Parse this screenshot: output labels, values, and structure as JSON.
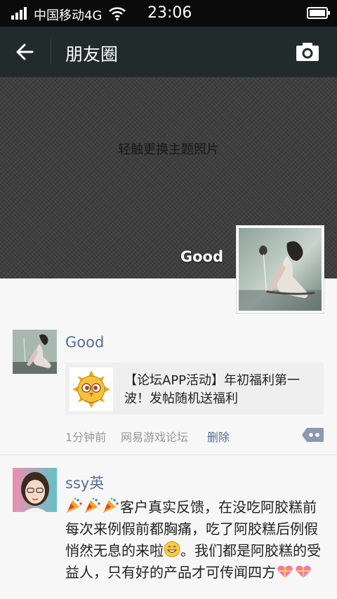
{
  "status_bar": {
    "carrier": "中国移动4G",
    "time": "23:06"
  },
  "nav": {
    "title": "朋友圈"
  },
  "cover": {
    "hint": "轻触更换主题照片",
    "user_name": "Good"
  },
  "posts": [
    {
      "author": "Good",
      "share_title": "【论坛APP活动】年初福利第一波！发帖随机送福利",
      "time": "1分钟前",
      "source": "网易游戏论坛",
      "delete_label": "删除"
    },
    {
      "author": "ssy英",
      "text_1": "客户真实反馈，在没吃阿胶糕前每次来例假前都胸痛，吃了阿胶糕后例假悄然无息的来啦",
      "text_2": "。我们都是阿胶糕的受益人，只有好的产品才可传闻四方"
    }
  ],
  "icons": [
    "signal-icon",
    "wifi-icon",
    "battery-icon",
    "back-arrow-icon",
    "camera-icon",
    "comment-icon",
    "party-popper-icon",
    "grin-emoji-icon",
    "gift-heart-icon"
  ],
  "colors": {
    "nav_background": "#212b2c",
    "status_background": "#0b0b0b",
    "link_blue": "#566f95",
    "meta_gray": "#9a9a9a",
    "cover_gray": "#3c3c3c"
  }
}
